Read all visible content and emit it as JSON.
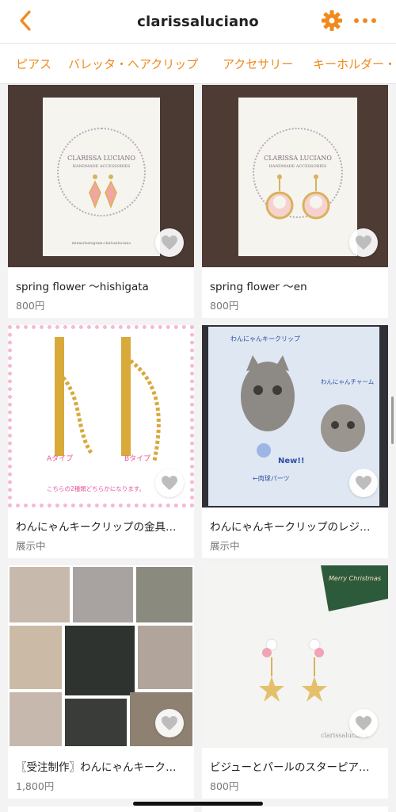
{
  "header": {
    "title": "clarissaluciano",
    "back_icon": "chevron-left-icon",
    "settings_icon": "gear-icon",
    "more_icon": "more-dots-icon",
    "accent_color": "#f08a1d"
  },
  "tabs": [
    {
      "label": "ピアス"
    },
    {
      "label": "バレッタ・ヘアクリップ"
    },
    {
      "label": "アクセサリー"
    },
    {
      "label": "キーホルダー・"
    }
  ],
  "products": [
    {
      "name": "spring flower 〜hishigata",
      "price": "800円"
    },
    {
      "name": "spring flower 〜en",
      "price": "800円"
    },
    {
      "name": "わんにゃんキークリップの金具…",
      "price": "展示中"
    },
    {
      "name": "わんにゃんキークリップのレジ…",
      "price": "展示中"
    },
    {
      "name": "〖受注制作〗わんにゃんキークリ…",
      "price": "1,800円"
    },
    {
      "name": "ビジューとパールのスターピア…",
      "price": "800円"
    }
  ],
  "artwork_text": {
    "brand": "CLARISSA LUCIANO",
    "brand_sub": "HANDMADE ACCESSORIES",
    "insta": "minne/instagram:clarissaluciano",
    "type_a": "Aタイプ",
    "type_b": "Bタイプ",
    "note": "こちらの2種類どちらかになります。",
    "cat_clip": "わんにゃんキークリップ",
    "cat_charm": "わんにゃんチャーム",
    "new": "New!!",
    "paw_parts": "←肉球パーツ",
    "xmas": "Merry Christmas",
    "watermark": "clarissaluciano"
  }
}
